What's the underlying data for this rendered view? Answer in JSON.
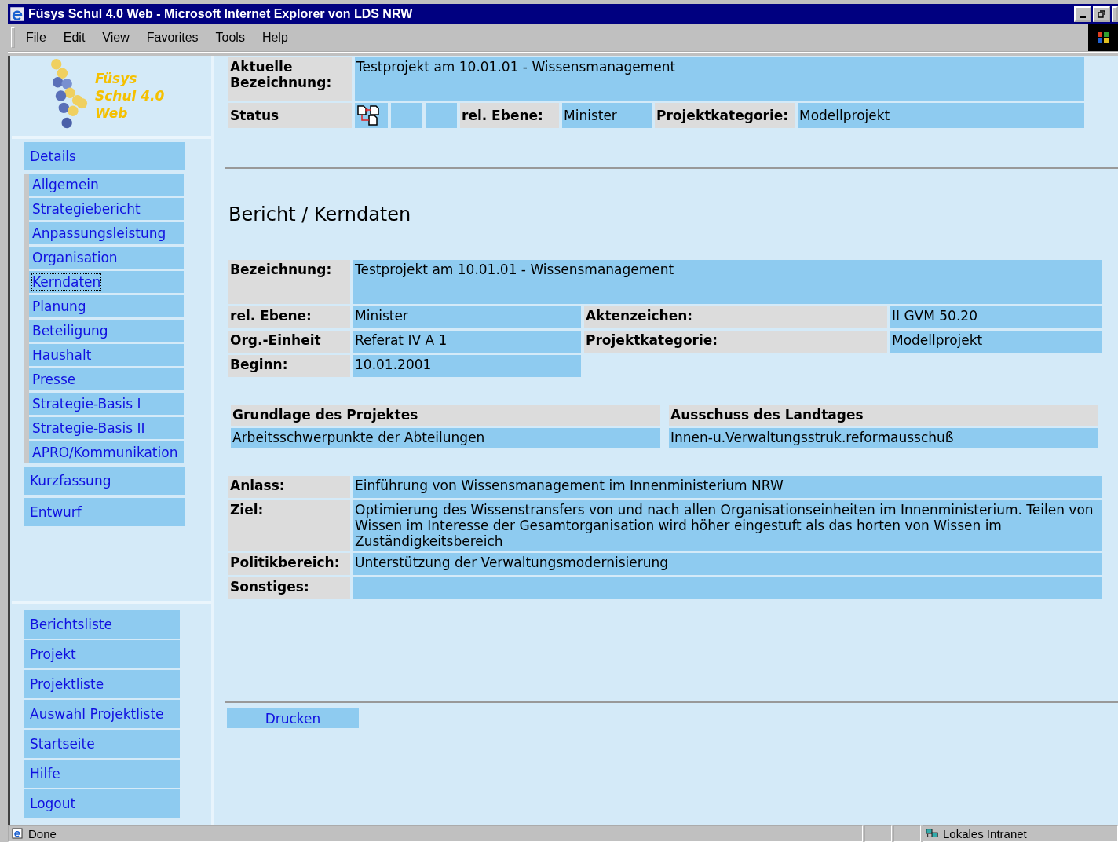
{
  "window": {
    "title": "Füsys Schul 4.0 Web - Microsoft Internet Explorer von LDS NRW"
  },
  "menu": [
    "File",
    "Edit",
    "View",
    "Favorites",
    "Tools",
    "Help"
  ],
  "logo": {
    "lines": [
      "Füsys",
      "Schul 4.0",
      "Web"
    ]
  },
  "nav": [
    {
      "label": "Details",
      "selected": false,
      "children": [
        {
          "label": "Allgemein",
          "selected": false
        },
        {
          "label": "Strategiebericht",
          "selected": false
        },
        {
          "label": "Anpassungsleistung",
          "selected": false
        },
        {
          "label": "Organisation",
          "selected": false
        },
        {
          "label": "Kerndaten",
          "selected": true
        },
        {
          "label": "Planung",
          "selected": false
        },
        {
          "label": "Beteiligung",
          "selected": false
        },
        {
          "label": "Haushalt",
          "selected": false
        },
        {
          "label": "Presse",
          "selected": false
        },
        {
          "label": "Strategie-Basis I",
          "selected": false
        },
        {
          "label": "Strategie-Basis II",
          "selected": false
        },
        {
          "label": "APRO/Kommunikation",
          "selected": false
        }
      ]
    },
    {
      "label": "Kurzfassung",
      "selected": false
    },
    {
      "label": "Entwurf",
      "selected": false
    }
  ],
  "nav_bottom": [
    "Berichtsliste",
    "Projekt",
    "Projektliste",
    "Auswahl Projektliste",
    "Startseite",
    "Hilfe",
    "Logout"
  ],
  "header": {
    "bezeichnung_label": "Aktuelle Bezeichnung:",
    "bezeichnung": "Testprojekt am 10.01.01 - Wissensmanagement",
    "status_label": "Status",
    "ebene_label": "rel. Ebene:",
    "ebene": "Minister",
    "kategorie_label": "Projektkategorie:",
    "kategorie": "Modellprojekt"
  },
  "heading": "Bericht / Kerndaten",
  "kerndaten": {
    "bezeichnung_label": "Bezeichnung:",
    "bezeichnung": "Testprojekt am 10.01.01 - Wissensmanagement",
    "rows": [
      {
        "label": "rel. Ebene:",
        "value": "Minister",
        "label2": "Aktenzeichen:",
        "value2": "II GVM 50.20"
      },
      {
        "label": "Org.-Einheit",
        "value": "Referat IV A 1",
        "label2": "Projektkategorie:",
        "value2": "Modellprojekt"
      },
      {
        "label": "Beginn:",
        "value": "10.01.2001"
      }
    ]
  },
  "grundlage": [
    {
      "label": "Grundlage des Projektes",
      "value": "Arbeitsschwerpunkte der Abteilungen"
    },
    {
      "label": "Ausschuss des Landtages",
      "value": "Innen-u.Verwaltungsstruk.reformausschuß"
    }
  ],
  "details": [
    {
      "label": "Anlass:",
      "value": "Einführung von Wissensmanagement im Innenministerium NRW"
    },
    {
      "label": "Ziel:",
      "value": "Optimierung des Wissenstransfers von und nach allen Organisationseinheiten im Innenministerium. Teilen von Wissen im Interesse der Gesamtorganisation wird höher eingestuft als das horten von Wissen im Zuständigkeitsbereich"
    },
    {
      "label": "Politikbereich:",
      "value": "Unterstützung der Verwaltungsmodernisierung"
    },
    {
      "label": "Sonstiges:"
    }
  ],
  "print_button": "Drucken",
  "status_bar": {
    "text": "Done",
    "zone": "Lokales Intranet"
  }
}
